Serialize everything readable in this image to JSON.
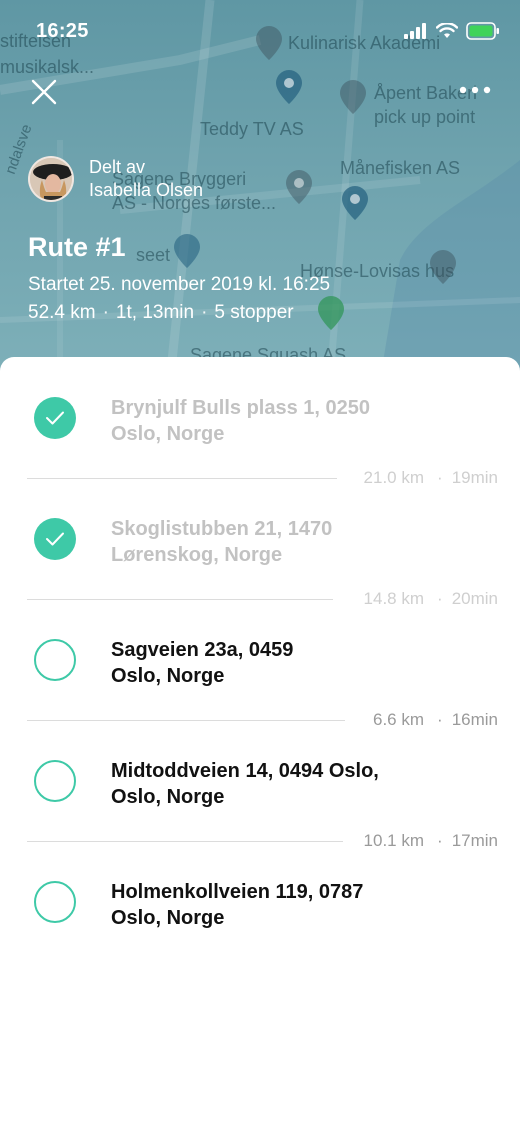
{
  "status": {
    "time": "16:25"
  },
  "map": {
    "labels": [
      {
        "id": "stiftelsen",
        "text": "stiftelsen"
      },
      {
        "id": "musikalsk",
        "text": "musikalsk..."
      },
      {
        "id": "kulinarisk",
        "text": "Kulinarisk Akademi"
      },
      {
        "id": "apent",
        "text": "Åpent Bakeri"
      },
      {
        "id": "pickup",
        "text": "pick up point"
      },
      {
        "id": "teddy",
        "text": "Teddy TV AS"
      },
      {
        "id": "manefisken",
        "text": "Månefisken AS"
      },
      {
        "id": "sagene",
        "text": "Sagene Bryggeri"
      },
      {
        "id": "norges",
        "text": "AS - Norges første..."
      },
      {
        "id": "honse",
        "text": "Hønse-Lovisas hus"
      },
      {
        "id": "museet",
        "text": "seet"
      },
      {
        "id": "squash",
        "text": "Sagene Squash AS"
      },
      {
        "id": "kandalsv",
        "text": "ndalsve"
      }
    ]
  },
  "header": {
    "shared_by_label": "Delt av",
    "shared_by_name": "Isabella Olsen",
    "route_title": "Rute #1",
    "started": "Startet 25. november 2019 kl. 16:25",
    "distance": "52.4 km",
    "duration": "1t, 13min",
    "stops": "5 stopper",
    "dot": "·"
  },
  "stops": [
    {
      "line1": "Brynjulf Bulls plass 1, 0250",
      "line2": "Oslo, Norge",
      "done": true
    },
    {
      "line1": "Skoglistubben 21, 1470",
      "line2": "Lørenskog, Norge",
      "done": true
    },
    {
      "line1": "Sagveien 23a, 0459",
      "line2": "Oslo, Norge",
      "done": false
    },
    {
      "line1": "Midtoddveien 14, 0494 Oslo,",
      "line2": "Oslo, Norge",
      "done": false
    },
    {
      "line1": "Holmenkollveien 119, 0787",
      "line2": "Oslo, Norge",
      "done": false
    }
  ],
  "segments": [
    {
      "distance": "21.0 km",
      "time": "19min",
      "done": true
    },
    {
      "distance": "14.8 km",
      "time": "20min",
      "done": true
    },
    {
      "distance": "6.6 km",
      "time": "16min",
      "done": false
    },
    {
      "distance": "10.1 km",
      "time": "17min",
      "done": false
    }
  ],
  "colors": {
    "accent": "#3ec9a7",
    "map": "#6fa3ae"
  },
  "icons": {
    "close": "close-icon",
    "more": "more-icon",
    "check": "checkmark-icon"
  }
}
